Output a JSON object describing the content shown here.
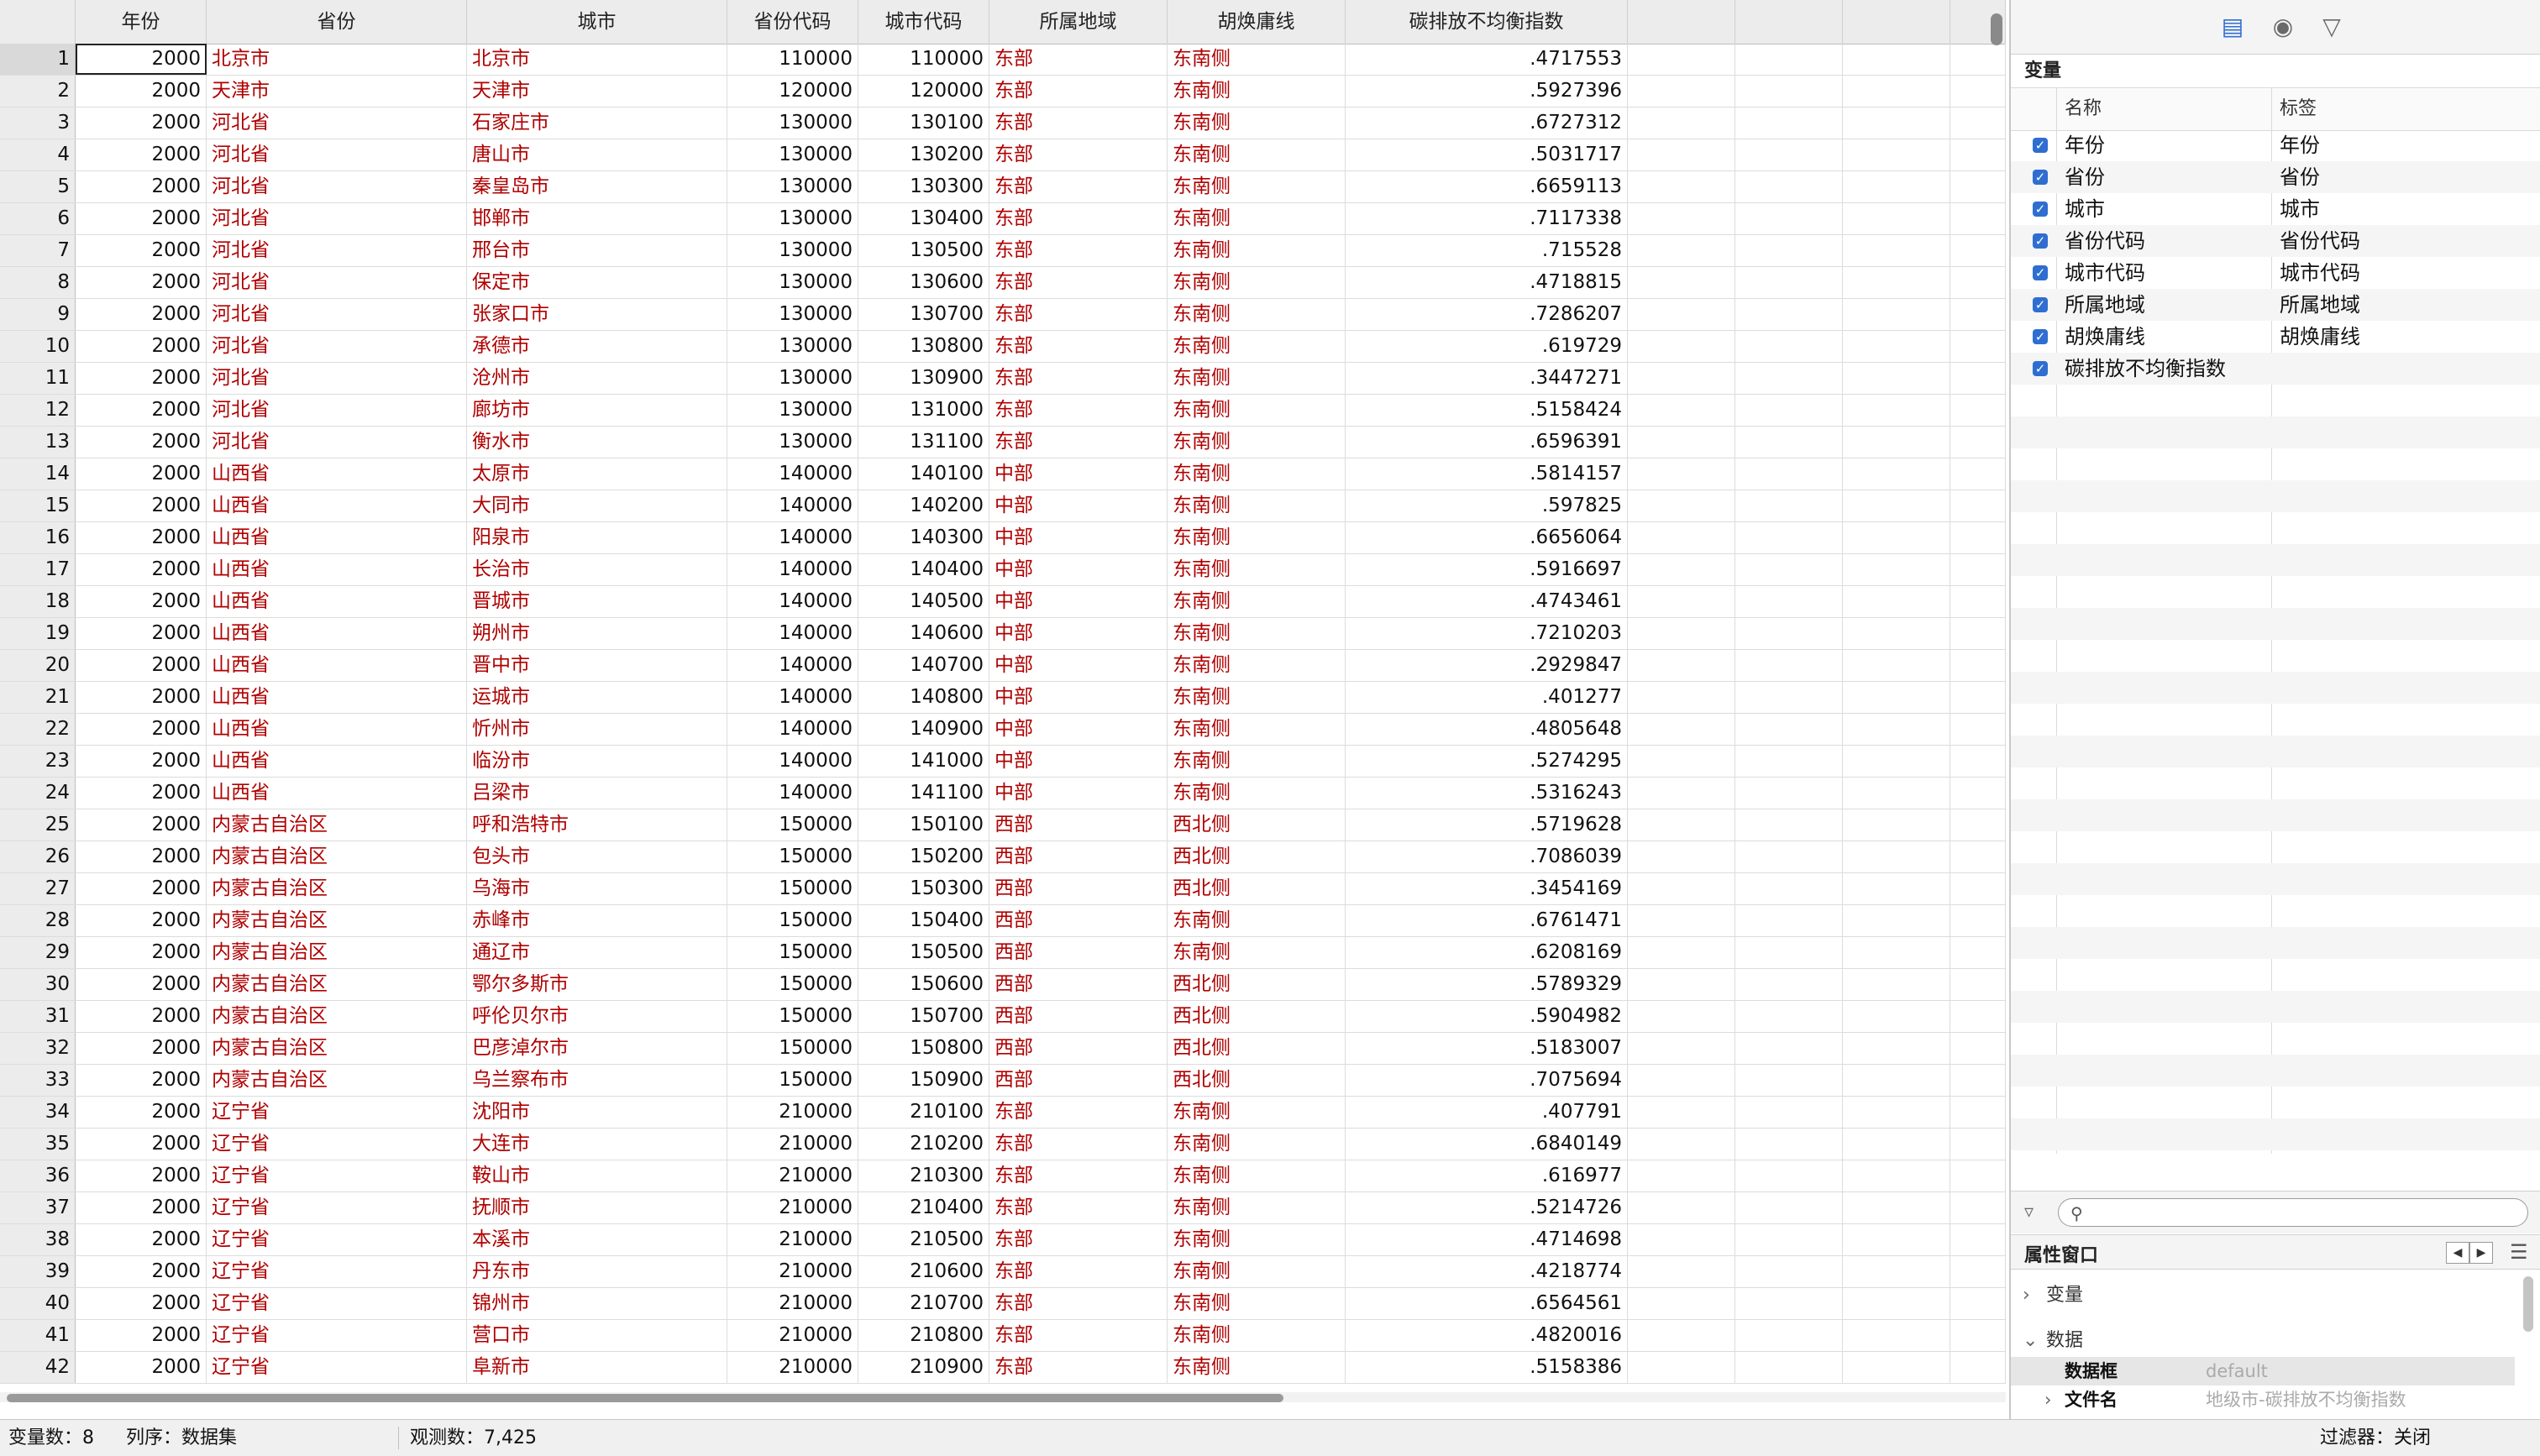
{
  "grid": {
    "headers": [
      "年份",
      "省份",
      "城市",
      "省份代码",
      "城市代码",
      "所属地域",
      "胡焕庸线",
      "碳排放不均衡指数"
    ],
    "rows": [
      [
        "2000",
        "北京市",
        "北京市",
        "110000",
        "110000",
        "东部",
        "东南侧",
        ".4717553"
      ],
      [
        "2000",
        "天津市",
        "天津市",
        "120000",
        "120000",
        "东部",
        "东南侧",
        ".5927396"
      ],
      [
        "2000",
        "河北省",
        "石家庄市",
        "130000",
        "130100",
        "东部",
        "东南侧",
        ".6727312"
      ],
      [
        "2000",
        "河北省",
        "唐山市",
        "130000",
        "130200",
        "东部",
        "东南侧",
        ".5031717"
      ],
      [
        "2000",
        "河北省",
        "秦皇岛市",
        "130000",
        "130300",
        "东部",
        "东南侧",
        ".6659113"
      ],
      [
        "2000",
        "河北省",
        "邯郸市",
        "130000",
        "130400",
        "东部",
        "东南侧",
        ".7117338"
      ],
      [
        "2000",
        "河北省",
        "邢台市",
        "130000",
        "130500",
        "东部",
        "东南侧",
        ".715528"
      ],
      [
        "2000",
        "河北省",
        "保定市",
        "130000",
        "130600",
        "东部",
        "东南侧",
        ".4718815"
      ],
      [
        "2000",
        "河北省",
        "张家口市",
        "130000",
        "130700",
        "东部",
        "东南侧",
        ".7286207"
      ],
      [
        "2000",
        "河北省",
        "承德市",
        "130000",
        "130800",
        "东部",
        "东南侧",
        ".619729"
      ],
      [
        "2000",
        "河北省",
        "沧州市",
        "130000",
        "130900",
        "东部",
        "东南侧",
        ".3447271"
      ],
      [
        "2000",
        "河北省",
        "廊坊市",
        "130000",
        "131000",
        "东部",
        "东南侧",
        ".5158424"
      ],
      [
        "2000",
        "河北省",
        "衡水市",
        "130000",
        "131100",
        "东部",
        "东南侧",
        ".6596391"
      ],
      [
        "2000",
        "山西省",
        "太原市",
        "140000",
        "140100",
        "中部",
        "东南侧",
        ".5814157"
      ],
      [
        "2000",
        "山西省",
        "大同市",
        "140000",
        "140200",
        "中部",
        "东南侧",
        ".597825"
      ],
      [
        "2000",
        "山西省",
        "阳泉市",
        "140000",
        "140300",
        "中部",
        "东南侧",
        ".6656064"
      ],
      [
        "2000",
        "山西省",
        "长治市",
        "140000",
        "140400",
        "中部",
        "东南侧",
        ".5916697"
      ],
      [
        "2000",
        "山西省",
        "晋城市",
        "140000",
        "140500",
        "中部",
        "东南侧",
        ".4743461"
      ],
      [
        "2000",
        "山西省",
        "朔州市",
        "140000",
        "140600",
        "中部",
        "东南侧",
        ".7210203"
      ],
      [
        "2000",
        "山西省",
        "晋中市",
        "140000",
        "140700",
        "中部",
        "东南侧",
        ".2929847"
      ],
      [
        "2000",
        "山西省",
        "运城市",
        "140000",
        "140800",
        "中部",
        "东南侧",
        ".401277"
      ],
      [
        "2000",
        "山西省",
        "忻州市",
        "140000",
        "140900",
        "中部",
        "东南侧",
        ".4805648"
      ],
      [
        "2000",
        "山西省",
        "临汾市",
        "140000",
        "141000",
        "中部",
        "东南侧",
        ".5274295"
      ],
      [
        "2000",
        "山西省",
        "吕梁市",
        "140000",
        "141100",
        "中部",
        "东南侧",
        ".5316243"
      ],
      [
        "2000",
        "内蒙古自治区",
        "呼和浩特市",
        "150000",
        "150100",
        "西部",
        "西北侧",
        ".5719628"
      ],
      [
        "2000",
        "内蒙古自治区",
        "包头市",
        "150000",
        "150200",
        "西部",
        "西北侧",
        ".7086039"
      ],
      [
        "2000",
        "内蒙古自治区",
        "乌海市",
        "150000",
        "150300",
        "西部",
        "西北侧",
        ".3454169"
      ],
      [
        "2000",
        "内蒙古自治区",
        "赤峰市",
        "150000",
        "150400",
        "西部",
        "东南侧",
        ".6761471"
      ],
      [
        "2000",
        "内蒙古自治区",
        "通辽市",
        "150000",
        "150500",
        "西部",
        "东南侧",
        ".6208169"
      ],
      [
        "2000",
        "内蒙古自治区",
        "鄂尔多斯市",
        "150000",
        "150600",
        "西部",
        "西北侧",
        ".5789329"
      ],
      [
        "2000",
        "内蒙古自治区",
        "呼伦贝尔市",
        "150000",
        "150700",
        "西部",
        "西北侧",
        ".5904982"
      ],
      [
        "2000",
        "内蒙古自治区",
        "巴彦淖尔市",
        "150000",
        "150800",
        "西部",
        "西北侧",
        ".5183007"
      ],
      [
        "2000",
        "内蒙古自治区",
        "乌兰察布市",
        "150000",
        "150900",
        "西部",
        "西北侧",
        ".7075694"
      ],
      [
        "2000",
        "辽宁省",
        "沈阳市",
        "210000",
        "210100",
        "东部",
        "东南侧",
        ".407791"
      ],
      [
        "2000",
        "辽宁省",
        "大连市",
        "210000",
        "210200",
        "东部",
        "东南侧",
        ".6840149"
      ],
      [
        "2000",
        "辽宁省",
        "鞍山市",
        "210000",
        "210300",
        "东部",
        "东南侧",
        ".616977"
      ],
      [
        "2000",
        "辽宁省",
        "抚顺市",
        "210000",
        "210400",
        "东部",
        "东南侧",
        ".5214726"
      ],
      [
        "2000",
        "辽宁省",
        "本溪市",
        "210000",
        "210500",
        "东部",
        "东南侧",
        ".4714698"
      ],
      [
        "2000",
        "辽宁省",
        "丹东市",
        "210000",
        "210600",
        "东部",
        "东南侧",
        ".4218774"
      ],
      [
        "2000",
        "辽宁省",
        "锦州市",
        "210000",
        "210700",
        "东部",
        "东南侧",
        ".6564561"
      ],
      [
        "2000",
        "辽宁省",
        "营口市",
        "210000",
        "210800",
        "东部",
        "东南侧",
        ".4820016"
      ],
      [
        "2000",
        "辽宁省",
        "阜新市",
        "210000",
        "210900",
        "东部",
        "东南侧",
        ".5158386"
      ]
    ]
  },
  "variables_panel": {
    "title": "变量",
    "col_name": "名称",
    "col_label": "标签",
    "icons": [
      "variables-icon",
      "camera-icon",
      "filter-icon"
    ],
    "items": [
      {
        "name": "年份",
        "label": "年份"
      },
      {
        "name": "省份",
        "label": "省份"
      },
      {
        "name": "城市",
        "label": "城市"
      },
      {
        "name": "省份代码",
        "label": "省份代码"
      },
      {
        "name": "城市代码",
        "label": "城市代码"
      },
      {
        "name": "所属地域",
        "label": "所属地域"
      },
      {
        "name": "胡焕庸线",
        "label": "胡焕庸线"
      },
      {
        "name": "碳排放不均衡指数",
        "label": ""
      }
    ],
    "search_placeholder": ""
  },
  "properties_panel": {
    "title": "属性窗口",
    "section_variables": "变量",
    "section_data": "数据",
    "frame_key": "数据框",
    "frame_value": "default",
    "filename_key": "文件名",
    "filename_value": "地级市-碳排放不均衡指数"
  },
  "status_bar": {
    "var_count": "变量数：8",
    "sort_order": "列序：数据集",
    "obs_count": "观测数：7,425",
    "filter": "过滤器：关闭"
  },
  "colors": {
    "string_text": "#b00000",
    "checkbox": "#2f6ed1",
    "header_bg": "#ececec"
  }
}
